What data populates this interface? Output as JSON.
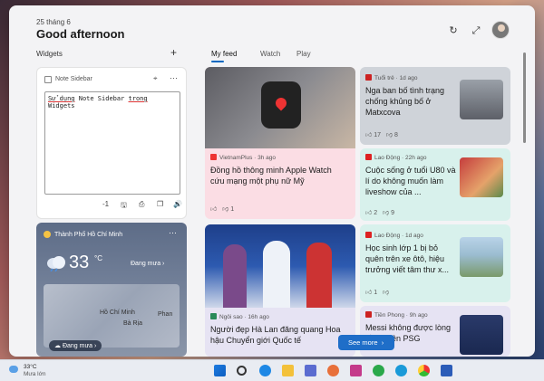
{
  "header": {
    "date": "25 tháng 6",
    "greeting": "Good afternoon"
  },
  "widgets": {
    "label": "Widgets",
    "add_icon": "+"
  },
  "tabs": [
    {
      "label": "My feed"
    },
    {
      "label": "Watch"
    },
    {
      "label": "Play"
    }
  ],
  "note": {
    "title": "Note Sidebar",
    "text_1": "Sử dụng",
    "text_2": " Note Sidebar ",
    "text_3": "trong",
    "text_4": " Widgets",
    "count": "-1"
  },
  "weather": {
    "location": "Thành Phố Hồ Chí Minh",
    "temp": "33",
    "unit": "°C",
    "condition": "Đang mưa",
    "pill": "Đang mưa",
    "map_labels": {
      "hcm": "Hồ Chí Minh",
      "ba_ria": "Bà Rịa",
      "phan": "Phan"
    }
  },
  "feed": {
    "card1": {
      "source": "VietnamPlus · 3h ago",
      "title": "Đồng hồ thông minh Apple Watch cứu mạng một phụ nữ Mỹ",
      "likes": "",
      "comments": "1"
    },
    "card2": {
      "source": "Tuổi trẻ · 1d ago",
      "title": "Nga ban bố tình trạng chống khủng bố ở Matxcova",
      "likes": "17",
      "comments": "8"
    },
    "card3": {
      "source": "Lao Động · 22h ago",
      "title": "Cuộc sống ở tuổi U80 và lí do không muốn làm liveshow của ...",
      "likes": "2",
      "comments": "9"
    },
    "card4": {
      "source": "Lao Động · 1d ago",
      "title": "Học sinh lớp 1 bị bỏ quên trên xe ôtô, hiệu trưởng viết tâm thư x...",
      "likes": "1",
      "comments": ""
    },
    "card5": {
      "source": "Ngôi sao · 16h ago",
      "title": "Người đẹp Hà Lan đăng quang Hoa hậu Chuyển giới Quốc tế"
    },
    "card6": {
      "source": "Tiền Phong · 9h ago",
      "title": "Messi không được lòng đồng viên PSG"
    }
  },
  "see_more": "See more",
  "taskbar": {
    "temp": "33°C",
    "cond": "Mưa lớn"
  },
  "colors": {
    "accent": "#0067c0",
    "card_pink": "#fbdde4",
    "card_mint": "#d8f1ec",
    "card_gray": "#cfd3d9",
    "card_lavender": "#e6e3f3"
  }
}
